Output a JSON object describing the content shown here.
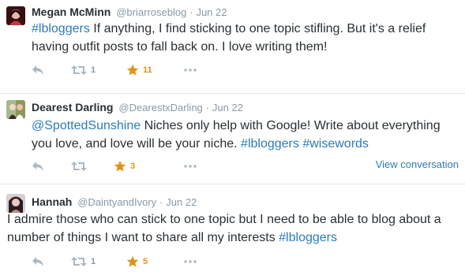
{
  "tweets": [
    {
      "name": "Megan McMinn",
      "handle": "@briarroseblog",
      "separator": "·",
      "time": "Jun 22",
      "text_parts": [
        "#lbloggers",
        " If anything, I find sticking to one topic stifling. But it's a relief having outfit posts to fall back on. I love writing them!"
      ],
      "retweets": "1",
      "favorites": "11",
      "avatar_colors": [
        "#3b0f12",
        "#c0384a"
      ]
    },
    {
      "name": "Dearest Darling",
      "handle": "@DearestxDarling",
      "separator": "·",
      "time": "Jun 22",
      "text_parts": [
        "@SpottedSunshine",
        " Niches only help with Google! Write about everything you love, and love will be your niche. ",
        "#lbloggers",
        " ",
        "#wisewords"
      ],
      "retweets": "",
      "favorites": "3",
      "view_conversation": "View conversation",
      "avatar_colors": [
        "#8a9a5b",
        "#f1d9c7"
      ]
    },
    {
      "name": "Hannah",
      "handle": "@DaintyandIvory",
      "separator": "·",
      "time": "Jun 22",
      "text_parts": [
        "I admire those who can stick to one topic but I need to be able to blog about a number of things I want to share all my interests ",
        "#lbloggers"
      ],
      "retweets": "1",
      "favorites": "5",
      "avatar_colors": [
        "#2a1d22",
        "#b78e8a"
      ]
    }
  ],
  "icons": {
    "reply": "reply-icon",
    "retweet": "retweet-icon",
    "favorite": "star-icon",
    "more": "more-icon"
  },
  "colors": {
    "link": "#2b7bb9",
    "favorite": "#e09317",
    "muted": "#8899a6",
    "icon": "#aab8c2"
  }
}
